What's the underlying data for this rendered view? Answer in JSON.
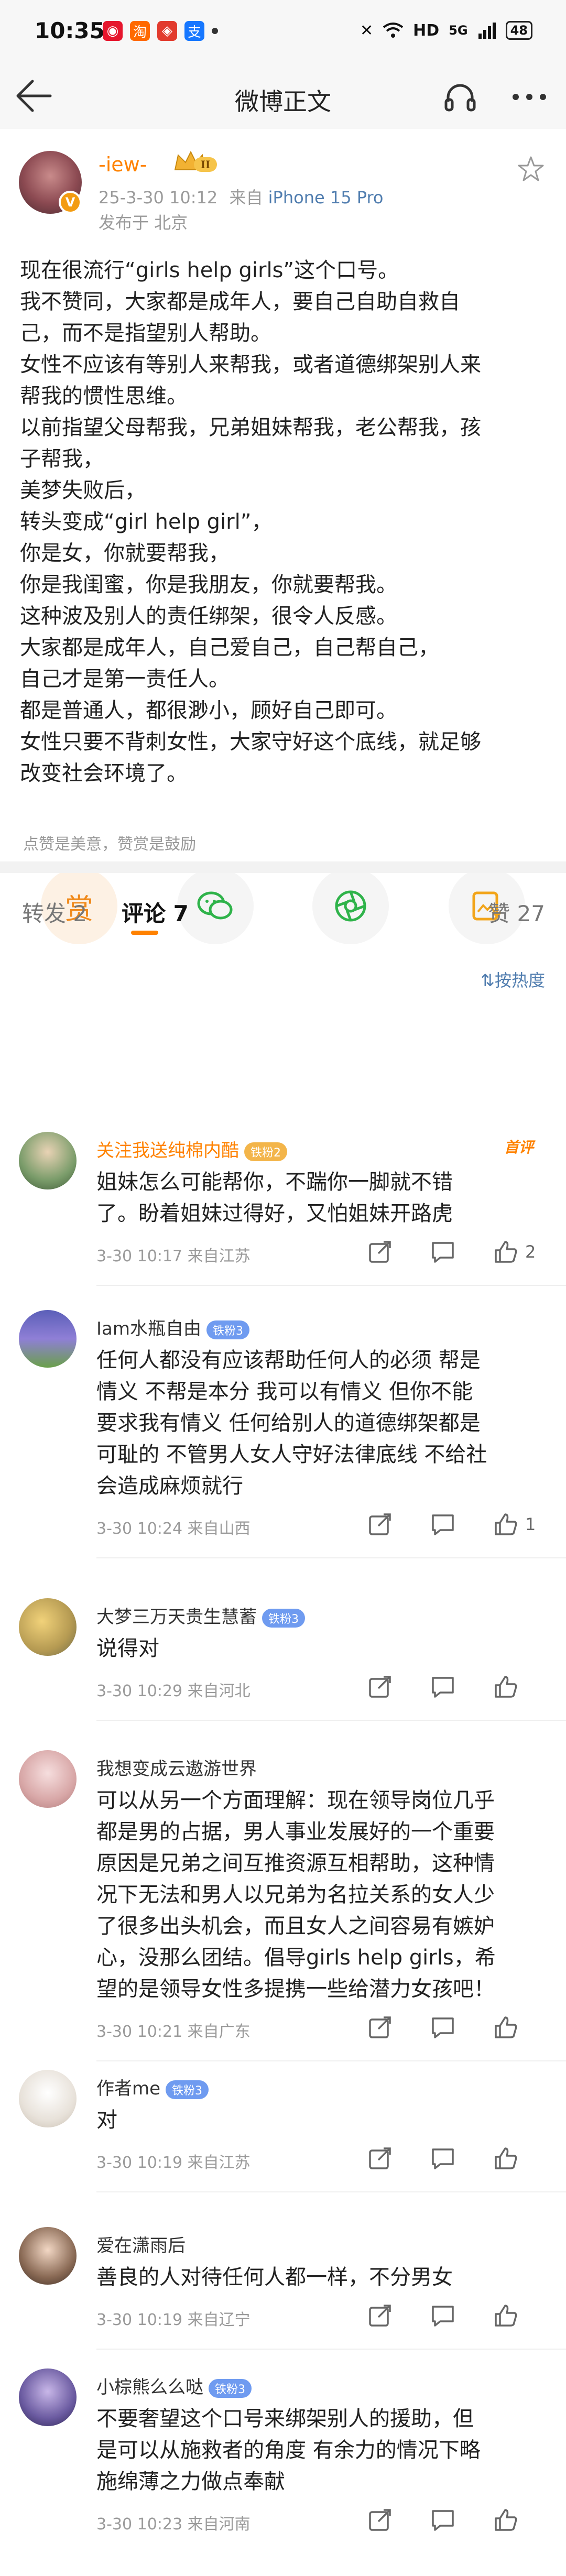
{
  "status": {
    "time": "10:35",
    "hd": "HD",
    "signal": "5G",
    "battery": "48"
  },
  "nav": {
    "title": "微博正文"
  },
  "post": {
    "author": "-iew-",
    "level": "II",
    "date": "25-3-30 10:12",
    "from_label": "来自",
    "device": "iPhone 15 Pro",
    "location": "发布于 北京",
    "lines": [
      "现在很流行“girls help girls”这个口号。",
      "我不赞同，大家都是成年人，要自己自助自救自",
      "己，而不是指望别人帮助。",
      "女性不应该有等别人来帮我，或者道德绑架别人来",
      "帮我的惯性思维。",
      "以前指望父母帮我，兄弟姐妹帮我，老公帮我，孩",
      "子帮我，",
      "美梦失败后，",
      "转头变成“girl help girl”，",
      "你是女，你就要帮我，",
      "你是我闺蜜，你是我朋友，你就要帮我。",
      "这种波及别人的责任绑架，很令人反感。",
      "大家都是成年人，自己爱自己，自己帮自己，",
      "自己才是第一责任人。",
      "都是普通人，都很渺小，顾好自己即可。",
      "女性只要不背刺女性，大家守好这个底线，就足够",
      "改变社会环境了。"
    ],
    "tip_text": "点赞是美意，赞赏是鼓励",
    "reward_label": "赏"
  },
  "tabs": {
    "repost": "转发 2",
    "comments": "评论 7",
    "likes": "赞 27"
  },
  "sort_label": "按热度",
  "comments": [
    {
      "name": "关注我送纯棉内酷",
      "badge": "铁粉2",
      "hot": "首评",
      "lines": [
        "姐妹怎么可能帮你，不踹你一脚就不错",
        "了。盼着姐妹过得好，又怕姐妹开路虎"
      ],
      "meta": "3-30 10:17  来自江苏",
      "likes": "2"
    },
    {
      "name": "Iam水瓶自由",
      "badge": "铁粉3",
      "lines": [
        "任何人都没有应该帮助任何人的必须  帮是",
        "情义 不帮是本分 我可以有情义 但你不能",
        "要求我有情义 任何给别人的道德绑架都是",
        "可耻的 不管男人女人守好法律底线 不给社",
        "会造成麻烦就行"
      ],
      "meta": "3-30 10:24  来自山西",
      "likes": "1"
    },
    {
      "name": "大梦三万天贵生慧蓄",
      "badge": "铁粉3",
      "lines": [
        "说得对"
      ],
      "meta": "3-30 10:29  来自河北",
      "likes": ""
    },
    {
      "name": "我想变成云遨游世界",
      "badge": "",
      "lines": [
        "可以从另一个方面理解：现在领导岗位几乎",
        "都是男的占据，男人事业发展好的一个重要",
        "原因是兄弟之间互推资源互相帮助，这种情",
        "况下无法和男人以兄弟为名拉关系的女人少",
        "了很多出头机会，而且女人之间容易有嫉妒",
        "心，没那么团结。倡导girls help girls，希",
        "望的是领导女性多提携一些给潜力女孩吧！"
      ],
      "meta": "3-30 10:21  来自广东",
      "likes": ""
    },
    {
      "name": "作者me",
      "badge": "铁粉3",
      "lines": [
        "对"
      ],
      "meta": "3-30 10:19  来自江苏",
      "likes": ""
    },
    {
      "name": "爱在潇雨后",
      "badge": "",
      "lines": [
        "善良的人对待任何人都一样，不分男女"
      ],
      "meta": "3-30 10:19  来自辽宁",
      "likes": ""
    },
    {
      "name": "小棕熊么么哒",
      "badge": "铁粉3",
      "lines": [
        "不要奢望这个口号来绑架别人的援助，但",
        "是可以从施救者的角度 有余力的情况下略",
        "施绵薄之力做点奉献"
      ],
      "meta": "3-30 10:23  来自河南",
      "likes": ""
    }
  ],
  "colors": {
    "accent": "#ff8200",
    "link": "#507daf",
    "meta": "#9a9a9a"
  }
}
